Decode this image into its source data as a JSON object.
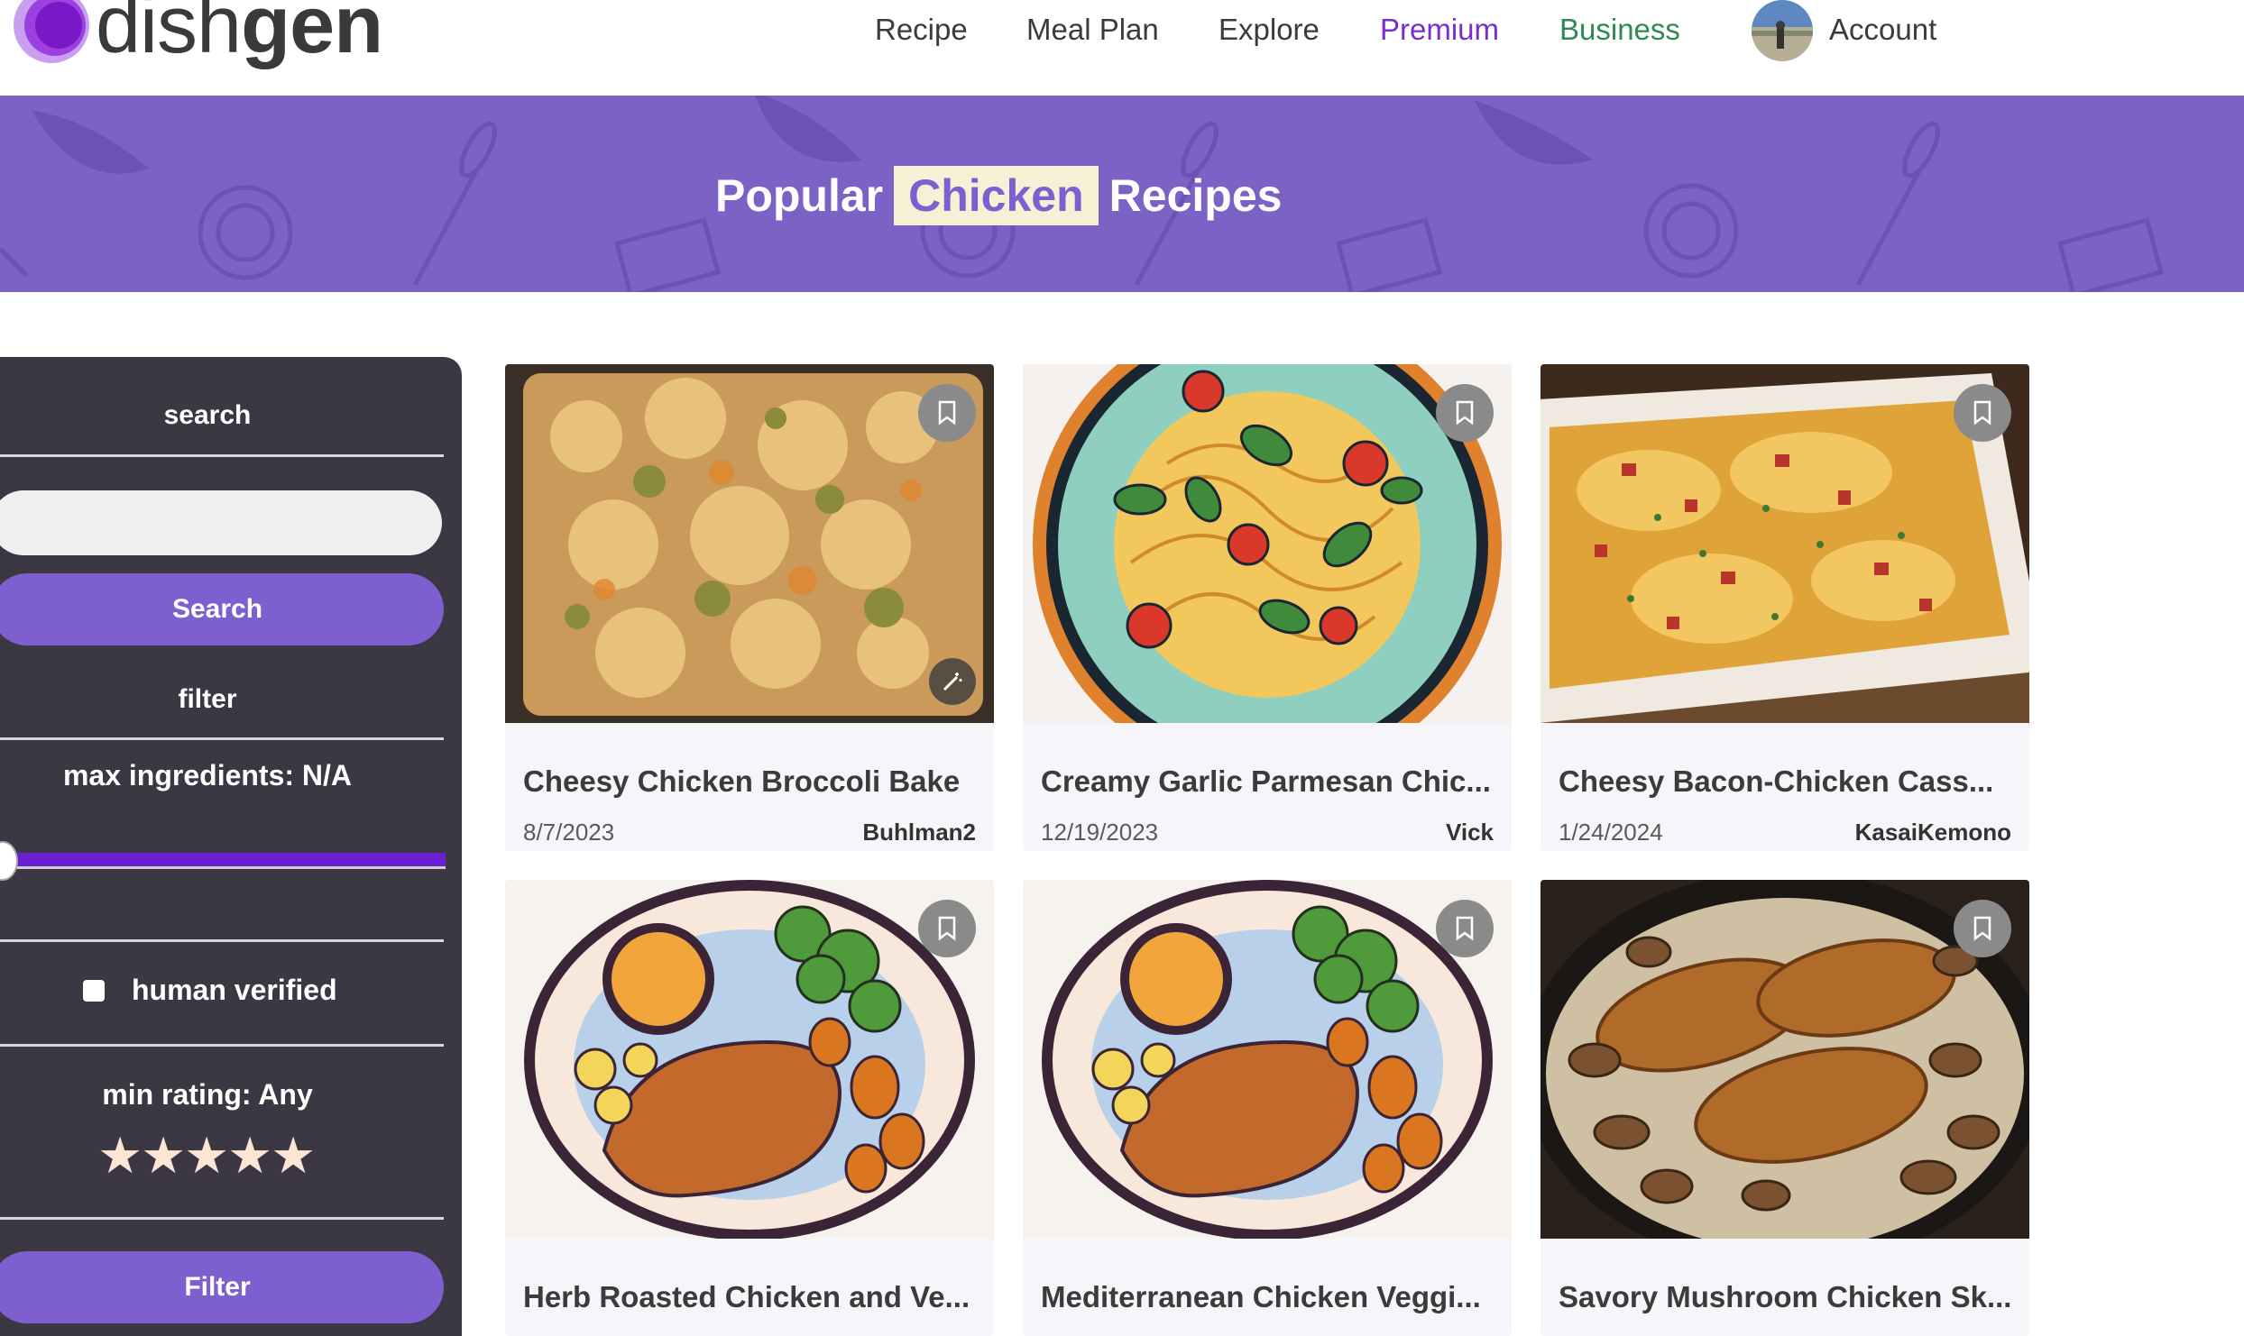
{
  "header": {
    "logo_light": "dish",
    "logo_bold": "gen",
    "nav": {
      "recipe": "Recipe",
      "meal_plan": "Meal Plan",
      "explore": "Explore",
      "premium": "Premium",
      "business": "Business",
      "account": "Account"
    }
  },
  "banner": {
    "prefix": "Popular",
    "highlight": "Chicken",
    "suffix": "Recipes"
  },
  "sidebar": {
    "search_heading": "search",
    "search_input_value": "",
    "search_button": "Search",
    "filter_heading": "filter",
    "max_ingredients_label": "max ingredients: N/A",
    "max_ingredients_slider_fraction": 0,
    "human_verified_label": "human verified",
    "human_verified_checked": false,
    "min_rating_label": "min rating: Any",
    "stars": [
      "★",
      "★",
      "★",
      "★",
      "★"
    ],
    "filter_button": "Filter"
  },
  "cards": [
    {
      "title": "Cheesy Chicken Broccoli Bake",
      "date": "8/7/2023",
      "author": "Buhlman2",
      "image": "broccoli-bake-photo"
    },
    {
      "title": "Creamy Garlic Parmesan Chic...",
      "date": "12/19/2023",
      "author": "Vick",
      "image": "pasta-illustration"
    },
    {
      "title": "Cheesy Bacon-Chicken Cass...",
      "date": "1/24/2024",
      "author": "KasaiKemono",
      "image": "casserole-photo"
    },
    {
      "title": "Herb Roasted Chicken and Ve...",
      "date": "",
      "author": "",
      "image": "roast-chicken-illustration"
    },
    {
      "title": "Mediterranean Chicken Veggi...",
      "date": "",
      "author": "",
      "image": "roast-chicken-illustration"
    },
    {
      "title": "Savory Mushroom Chicken Sk...",
      "date": "",
      "author": "",
      "image": "mushroom-chicken-photo"
    }
  ],
  "colors": {
    "brand_purple": "#7d5fd0",
    "banner_bg": "#7c62c4",
    "premium": "#7a2ecf",
    "business": "#2e8a52",
    "sidebar_bg": "#3c3843"
  }
}
